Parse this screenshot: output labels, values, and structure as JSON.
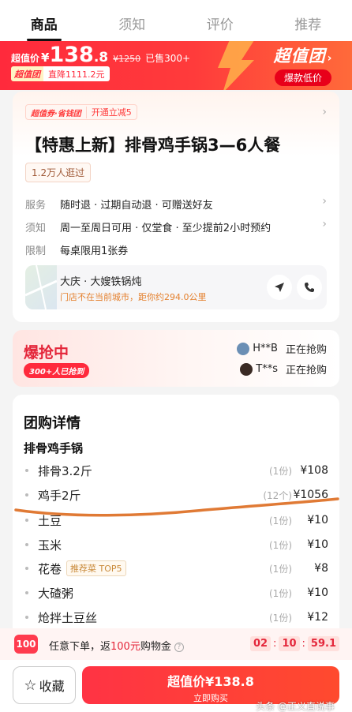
{
  "tabs": [
    "商品",
    "须知",
    "评价",
    "推荐"
  ],
  "banner": {
    "prefix": "超值价",
    "currency": "¥",
    "price_int": "138",
    "price_dec": ".8",
    "original_price": "¥1250",
    "sold": "已售300+",
    "brand_tag": "超值团",
    "discount": "直降1111.2元",
    "brand_title": "超值团",
    "brand_pill": "爆款低价"
  },
  "product": {
    "coupon_tag": "超值券·省钱团",
    "coupon_offer": "开通立减5",
    "title": "【特惠上新】排骨鸡手锅3—6人餐",
    "visitors": "1.2万人逛过",
    "info": [
      {
        "label": "服务",
        "value": "随时退 · 过期自动退 · 可赠送好友"
      },
      {
        "label": "须知",
        "value": "周一至周日可用 · 仅堂食 · 至少提前2小时预约"
      },
      {
        "label": "限制",
        "value": "每桌限用1张券"
      }
    ],
    "store": {
      "name": "大庆 · 大嫂铁锅炖",
      "note": "门店不在当前城市，距你约294.0公里"
    }
  },
  "snap": {
    "title": "爆抢中",
    "badge": "300+人已抢到",
    "buyers": [
      {
        "name": "H**B",
        "status": "正在抢购"
      },
      {
        "name": "T**s",
        "status": "正在抢购"
      }
    ]
  },
  "details": {
    "title": "团购详情",
    "subtitle": "排骨鸡手锅",
    "items": [
      {
        "name": "排骨3.2斤",
        "qty": "(1份)",
        "price": "¥108",
        "tag": ""
      },
      {
        "name": "鸡手2斤",
        "qty": "(12个)",
        "price": "¥1056",
        "tag": ""
      },
      {
        "name": "土豆",
        "qty": "(1份)",
        "price": "¥10",
        "tag": ""
      },
      {
        "name": "玉米",
        "qty": "(1份)",
        "price": "¥10",
        "tag": ""
      },
      {
        "name": "花卷",
        "qty": "(1份)",
        "price": "¥8",
        "tag": "推荐菜 TOP5"
      },
      {
        "name": "大碴粥",
        "qty": "(1份)",
        "price": "¥10",
        "tag": ""
      },
      {
        "name": "炝拌土豆丝",
        "qty": "(1份)",
        "price": "¥12",
        "tag": ""
      }
    ]
  },
  "promo": {
    "badge": "100",
    "text_a": "任意下单，返",
    "text_hl": "100元",
    "text_b": "购物金",
    "timer": [
      "02",
      "10",
      "59.1"
    ]
  },
  "bottom": {
    "fav": "收藏",
    "buy_main": "超值价¥138.8",
    "buy_sub": "立即购买",
    "watermark": "头条 @正义直说事"
  },
  "colors": {
    "brand_red": "#ff2a3c",
    "accent_orange": "#e4802e",
    "scribble": "#e07a35"
  }
}
